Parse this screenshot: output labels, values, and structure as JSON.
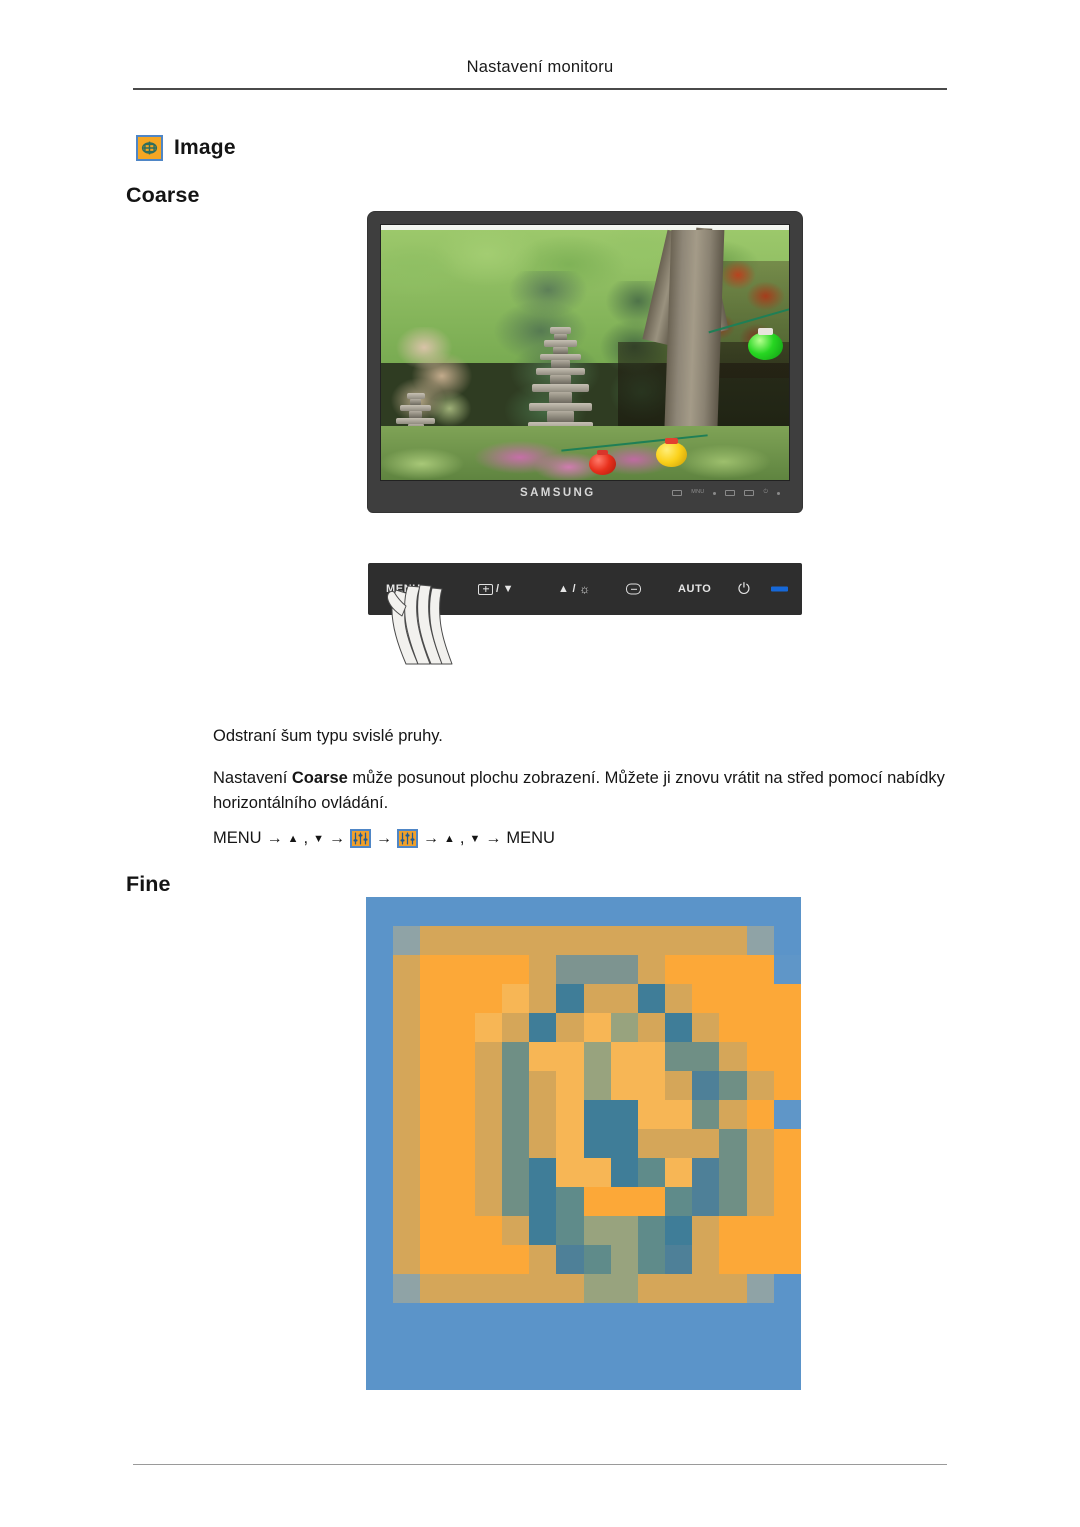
{
  "header": {
    "title": "Nastavení monitoru"
  },
  "section": {
    "icon_name": "image-menu-icon",
    "title": "Image"
  },
  "headings": {
    "coarse": "Coarse",
    "fine": "Fine"
  },
  "monitor": {
    "brand_logo": "SAMSUNG",
    "bezel_marks": [
      "source",
      "mnu",
      "dot",
      "menu",
      "box",
      "power",
      "led"
    ],
    "photo_description": "Zahradní scéna s kamennou pagodou, stromy a barevnými lampiony"
  },
  "control_bar": {
    "buttons": [
      {
        "label": "MENU",
        "name": "menu-button"
      },
      {
        "label": "",
        "secondary": "▼",
        "name": "source-down-button"
      },
      {
        "label": "▲",
        "secondary": "",
        "name": "brightness-up-button"
      },
      {
        "label": "",
        "name": "enter-button"
      },
      {
        "label": "AUTO",
        "name": "auto-button"
      },
      {
        "label": "",
        "name": "power-button"
      }
    ],
    "separator": "/",
    "auto_label": "AUTO",
    "menu_label": "MENU",
    "power_glyph": "⏻",
    "sun_glyph": "☼",
    "up_glyph": "▲",
    "down_glyph": "▼",
    "led_color": "#1668d8"
  },
  "body": {
    "paragraph_1": "Odstraní šum typu svislé pruhy.",
    "paragraph_2_pre": "Nastavení ",
    "paragraph_2_bold": "Coarse",
    "paragraph_2_post": " může posunout plochu zobrazení. Můžete ji znovu vrátit na střed pomocí nabídky horizontálního ovládání."
  },
  "menu_path": {
    "start": "MENU",
    "arrow": "→",
    "comma": ",",
    "up": "▲",
    "down": "▼",
    "end": "MENU",
    "icon_name": "coarse-fine-slider-icon"
  },
  "colors": {
    "accent_orange": "#f5a623",
    "accent_blue": "#4f86c6",
    "bezel": "#3e3e3e",
    "led_blue": "#1668d8",
    "text": "#151515"
  },
  "pixel_image": {
    "name": "fine-icon-magnified",
    "cols": 16,
    "rows": 17,
    "palette": {
      "B": "#5b94c9",
      "b": "#5f96c8",
      "g": "#8fa3a6",
      "G": "#7d9490",
      "t": "#4e8098",
      "T": "#3f7d98",
      "s": "#6f8f85",
      "S": "#5f8b8a",
      "d": "#d5a659",
      "D": "#cfa05c",
      "o": "#fca838",
      "O": "#fbae42",
      "y": "#f7b655",
      "Y": "#e8ab56",
      "m": "#a99a6e",
      "M": "#98a37e",
      "k": "#417f93"
    },
    "grid": [
      "BBBBBBBBBBBBBBBB",
      "BgddddddddddddgB",
      "BdoooodGGGdoooob",
      "BdoooydTddTdoooob",
      "BdooydTdyMdTdooob",
      "BdoodsyyMyyssdoob",
      "BdoodsdyMyydtsdob",
      "BdoodsdyTTyysdob",
      "BdoodsdyTTdddsdob",
      "BdoodsTyyTSytsdob",
      "BdoodsTSoooStsdob",
      "BdooodTSMMSTdooob",
      "BdoooodtSMStdooob",
      "BgddddddMMddddgB",
      "BBBBBBBBBBBBBBBB",
      "BBBBBBBBBBBBBBBB",
      "BBBBBBBBBBBBBBBB"
    ]
  }
}
